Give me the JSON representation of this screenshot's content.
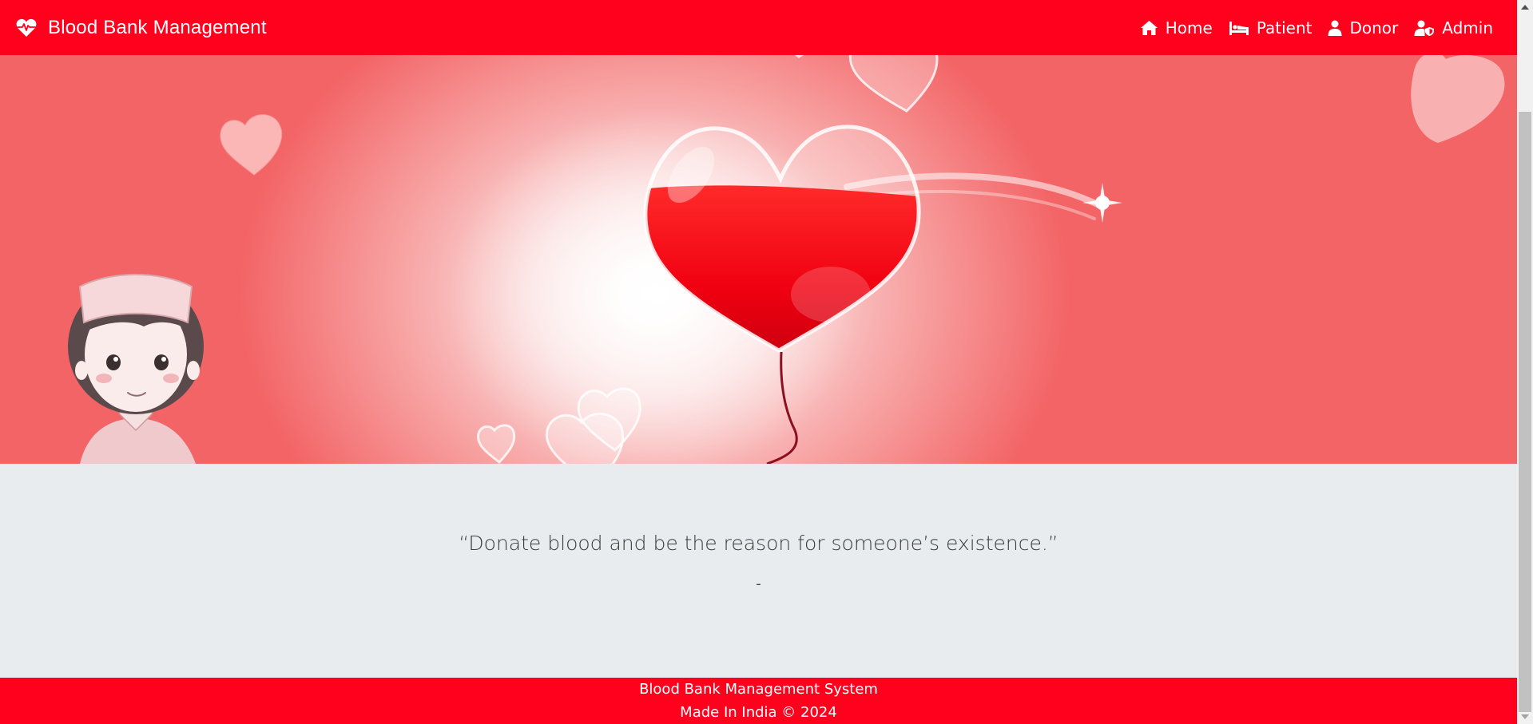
{
  "navbar": {
    "brand_title": "Blood Bank Management",
    "brand_icon": "heart-pulse-icon",
    "links": [
      {
        "label": "Home",
        "icon": "home-icon"
      },
      {
        "label": "Patient",
        "icon": "bed-icon"
      },
      {
        "label": "Donor",
        "icon": "user-icon"
      },
      {
        "label": "Admin",
        "icon": "user-shield-icon"
      }
    ]
  },
  "hero": {
    "image_description": "blood-heart-balloon-banner"
  },
  "quote": {
    "text": "“Donate blood and be the reason for someone’s existence.”",
    "author": "-"
  },
  "footer": {
    "line1": "Blood Bank Management System",
    "line2": "Made In India © 2024"
  },
  "colors": {
    "primary": "#ff001d",
    "quote_bg": "#e9ecef",
    "hero_edge": "#f36466"
  }
}
